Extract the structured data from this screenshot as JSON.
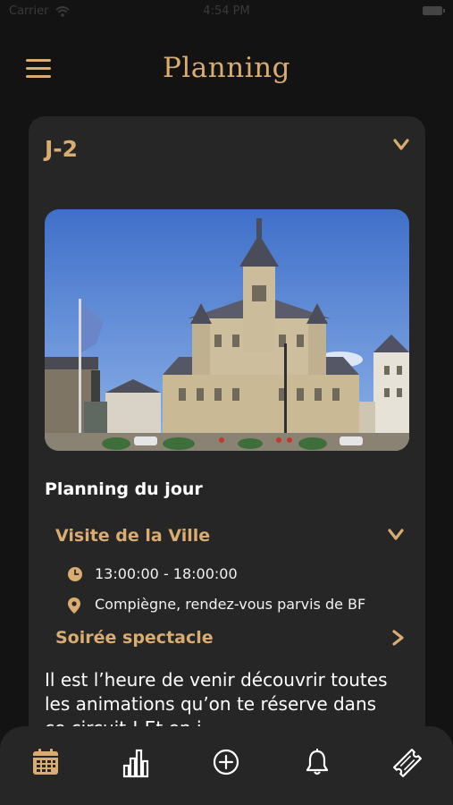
{
  "status_bar": {
    "carrier": "Carrier",
    "time": "4:54 PM"
  },
  "header": {
    "title": "Planning",
    "menu_icon": "hamburger-menu-icon"
  },
  "day_card": {
    "day_label": "J-2",
    "image_subject": "Compiègne town hall",
    "section_title": "Planning du jour",
    "events": [
      {
        "title": "Visite de la Ville",
        "expanded": true,
        "time": "13:00:00 - 18:00:00",
        "location": "Compiègne, rendez-vous parvis de BF"
      },
      {
        "title": "Soirée spectacle",
        "expanded": false
      }
    ],
    "description": "Il est l’heure de venir découvrir toutes les animations qu’on te réserve dans ce circuit ! Et en j"
  },
  "tabbar": {
    "tabs": [
      {
        "name": "calendar",
        "icon": "calendar-icon",
        "active": true
      },
      {
        "name": "stats",
        "icon": "bar-chart-icon",
        "active": false
      },
      {
        "name": "add",
        "icon": "plus-circle-icon",
        "active": false
      },
      {
        "name": "notifications",
        "icon": "bell-icon",
        "active": false
      },
      {
        "name": "tickets",
        "icon": "ticket-icon",
        "active": false
      }
    ]
  },
  "colors": {
    "accent": "#d9ac72",
    "background": "#131313",
    "card": "#262626"
  }
}
